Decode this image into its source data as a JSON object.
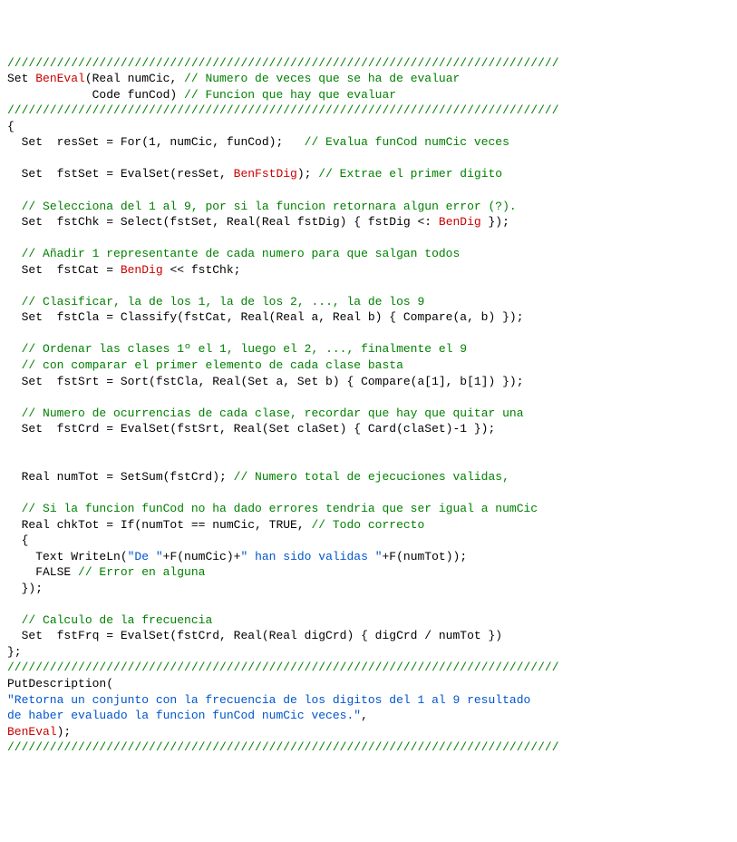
{
  "lines": [
    {
      "segs": [
        {
          "cls": "c-green",
          "t": "//////////////////////////////////////////////////////////////////////////////"
        }
      ]
    },
    {
      "segs": [
        {
          "cls": "c-black",
          "t": "Set "
        },
        {
          "cls": "c-red",
          "t": "BenEval"
        },
        {
          "cls": "c-black",
          "t": "(Real numCic, "
        },
        {
          "cls": "c-green",
          "t": "// Numero de veces que se ha de evaluar"
        }
      ]
    },
    {
      "segs": [
        {
          "cls": "c-black",
          "t": "            Code funCod) "
        },
        {
          "cls": "c-green",
          "t": "// Funcion que hay que evaluar"
        }
      ]
    },
    {
      "segs": [
        {
          "cls": "c-green",
          "t": "//////////////////////////////////////////////////////////////////////////////"
        }
      ]
    },
    {
      "segs": [
        {
          "cls": "c-black",
          "t": "{"
        }
      ]
    },
    {
      "segs": [
        {
          "cls": "c-black",
          "t": "  Set  resSet = For(1, numCic, funCod);   "
        },
        {
          "cls": "c-green",
          "t": "// Evalua funCod numCic veces"
        }
      ]
    },
    {
      "segs": [
        {
          "cls": "c-black",
          "t": ""
        }
      ]
    },
    {
      "segs": [
        {
          "cls": "c-black",
          "t": "  Set  fstSet = EvalSet(resSet, "
        },
        {
          "cls": "c-red",
          "t": "BenFstDig"
        },
        {
          "cls": "c-black",
          "t": "); "
        },
        {
          "cls": "c-green",
          "t": "// Extrae el primer digito"
        }
      ]
    },
    {
      "segs": [
        {
          "cls": "c-black",
          "t": ""
        }
      ]
    },
    {
      "segs": [
        {
          "cls": "c-black",
          "t": "  "
        },
        {
          "cls": "c-green",
          "t": "// Selecciona del 1 al 9, por si la funcion retornara algun error (?)."
        }
      ]
    },
    {
      "segs": [
        {
          "cls": "c-black",
          "t": "  Set  fstChk = Select(fstSet, Real(Real fstDig) { fstDig <: "
        },
        {
          "cls": "c-red",
          "t": "BenDig"
        },
        {
          "cls": "c-black",
          "t": " });"
        }
      ]
    },
    {
      "segs": [
        {
          "cls": "c-black",
          "t": ""
        }
      ]
    },
    {
      "segs": [
        {
          "cls": "c-black",
          "t": "  "
        },
        {
          "cls": "c-green",
          "t": "// Añadir 1 representante de cada numero para que salgan todos"
        }
      ]
    },
    {
      "segs": [
        {
          "cls": "c-black",
          "t": "  Set  fstCat = "
        },
        {
          "cls": "c-red",
          "t": "BenDig"
        },
        {
          "cls": "c-black",
          "t": " << fstChk;"
        }
      ]
    },
    {
      "segs": [
        {
          "cls": "c-black",
          "t": ""
        }
      ]
    },
    {
      "segs": [
        {
          "cls": "c-black",
          "t": "  "
        },
        {
          "cls": "c-green",
          "t": "// Clasificar, la de los 1, la de los 2, ..., la de los 9"
        }
      ]
    },
    {
      "segs": [
        {
          "cls": "c-black",
          "t": "  Set  fstCla = Classify(fstCat, Real(Real a, Real b) { Compare(a, b) });"
        }
      ]
    },
    {
      "segs": [
        {
          "cls": "c-black",
          "t": ""
        }
      ]
    },
    {
      "segs": [
        {
          "cls": "c-black",
          "t": "  "
        },
        {
          "cls": "c-green",
          "t": "// Ordenar las clases 1º el 1, luego el 2, ..., finalmente el 9"
        }
      ]
    },
    {
      "segs": [
        {
          "cls": "c-black",
          "t": "  "
        },
        {
          "cls": "c-green",
          "t": "// con comparar el primer elemento de cada clase basta"
        }
      ]
    },
    {
      "segs": [
        {
          "cls": "c-black",
          "t": "  Set  fstSrt = Sort(fstCla, Real(Set a, Set b) { Compare(a[1], b[1]) });"
        }
      ]
    },
    {
      "segs": [
        {
          "cls": "c-black",
          "t": ""
        }
      ]
    },
    {
      "segs": [
        {
          "cls": "c-black",
          "t": "  "
        },
        {
          "cls": "c-green",
          "t": "// Numero de ocurrencias de cada clase, recordar que hay que quitar una"
        }
      ]
    },
    {
      "segs": [
        {
          "cls": "c-black",
          "t": "  Set  fstCrd = EvalSet(fstSrt, Real(Set claSet) { Card(claSet)-1 });"
        }
      ]
    },
    {
      "segs": [
        {
          "cls": "c-black",
          "t": ""
        }
      ]
    },
    {
      "segs": [
        {
          "cls": "c-black",
          "t": ""
        }
      ]
    },
    {
      "segs": [
        {
          "cls": "c-black",
          "t": "  Real numTot = SetSum(fstCrd); "
        },
        {
          "cls": "c-green",
          "t": "// Numero total de ejecuciones validas,"
        }
      ]
    },
    {
      "segs": [
        {
          "cls": "c-black",
          "t": ""
        }
      ]
    },
    {
      "segs": [
        {
          "cls": "c-black",
          "t": "  "
        },
        {
          "cls": "c-green",
          "t": "// Si la funcion funCod no ha dado errores tendria que ser igual a numCic"
        }
      ]
    },
    {
      "segs": [
        {
          "cls": "c-black",
          "t": "  Real chkTot = If(numTot == numCic, TRUE, "
        },
        {
          "cls": "c-green",
          "t": "// Todo correcto"
        }
      ]
    },
    {
      "segs": [
        {
          "cls": "c-black",
          "t": "  {"
        }
      ]
    },
    {
      "segs": [
        {
          "cls": "c-black",
          "t": "    Text WriteLn("
        },
        {
          "cls": "c-blue",
          "t": "\"De \""
        },
        {
          "cls": "c-black",
          "t": "+F(numCic)+"
        },
        {
          "cls": "c-blue",
          "t": "\" han sido validas \""
        },
        {
          "cls": "c-black",
          "t": "+F(numTot));"
        }
      ]
    },
    {
      "segs": [
        {
          "cls": "c-black",
          "t": "    FALSE "
        },
        {
          "cls": "c-green",
          "t": "// Error en alguna"
        }
      ]
    },
    {
      "segs": [
        {
          "cls": "c-black",
          "t": "  });"
        }
      ]
    },
    {
      "segs": [
        {
          "cls": "c-black",
          "t": ""
        }
      ]
    },
    {
      "segs": [
        {
          "cls": "c-black",
          "t": "  "
        },
        {
          "cls": "c-green",
          "t": "// Calculo de la frecuencia"
        }
      ]
    },
    {
      "segs": [
        {
          "cls": "c-black",
          "t": "  Set  fstFrq = EvalSet(fstCrd, Real(Real digCrd) { digCrd / numTot })"
        }
      ]
    },
    {
      "segs": [
        {
          "cls": "c-black",
          "t": "};"
        }
      ]
    },
    {
      "segs": [
        {
          "cls": "c-green",
          "t": "//////////////////////////////////////////////////////////////////////////////"
        }
      ]
    },
    {
      "segs": [
        {
          "cls": "c-black",
          "t": "PutDescription("
        }
      ]
    },
    {
      "segs": [
        {
          "cls": "c-blue",
          "t": "\"Retorna un conjunto con la frecuencia de los digitos del 1 al 9 resultado"
        }
      ]
    },
    {
      "segs": [
        {
          "cls": "c-blue",
          "t": "de haber evaluado la funcion funCod numCic veces.\""
        },
        {
          "cls": "c-black",
          "t": ","
        }
      ]
    },
    {
      "segs": [
        {
          "cls": "c-red",
          "t": "BenEval"
        },
        {
          "cls": "c-black",
          "t": ");"
        }
      ]
    },
    {
      "segs": [
        {
          "cls": "c-green",
          "t": "//////////////////////////////////////////////////////////////////////////////"
        }
      ]
    }
  ]
}
